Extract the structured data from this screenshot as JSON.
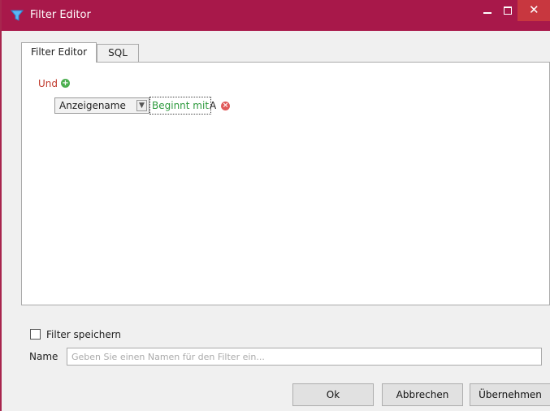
{
  "window": {
    "title": "Filter Editor",
    "icon": "funnel-icon",
    "accent_color": "#a8184a"
  },
  "tabs": [
    {
      "label": "Filter Editor",
      "selected": true
    },
    {
      "label": "SQL",
      "selected": false
    }
  ],
  "filter": {
    "group_operator": "Und",
    "condition": {
      "field": "Anzeigename",
      "operator": "Beginnt mit",
      "value": "A"
    }
  },
  "save_filter": {
    "checkbox_label": "Filter speichern",
    "checked": false
  },
  "name_field": {
    "label": "Name",
    "value": "",
    "placeholder": "Geben Sie einen Namen für den Filter ein..."
  },
  "buttons": {
    "ok": "Ok",
    "cancel": "Abbrechen",
    "apply": "Übernehmen"
  }
}
